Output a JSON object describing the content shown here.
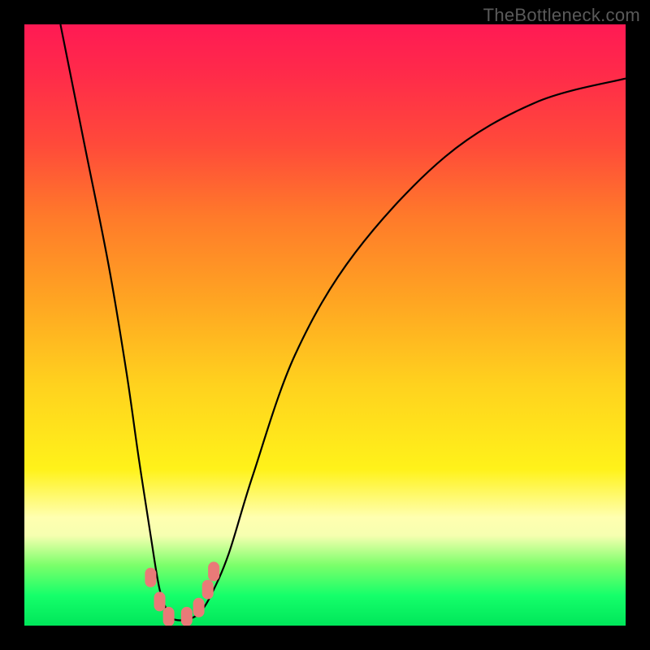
{
  "watermark": "TheBottleneck.com",
  "chart_data": {
    "type": "line",
    "title": "",
    "xlabel": "",
    "ylabel": "",
    "xlim": [
      0,
      100
    ],
    "ylim": [
      0,
      100
    ],
    "series": [
      {
        "name": "curve",
        "x": [
          6,
          10,
          14,
          17,
          19,
          21,
          22.5,
          24,
          25,
          27,
          29,
          31,
          34,
          38,
          45,
          55,
          70,
          85,
          100
        ],
        "values": [
          100,
          80,
          60,
          42,
          28,
          15,
          6,
          2,
          1,
          1,
          2,
          5,
          12,
          25,
          45,
          62,
          78,
          87,
          91
        ]
      }
    ],
    "markers": [
      {
        "x": 21.0,
        "y": 8.0
      },
      {
        "x": 22.5,
        "y": 4.0
      },
      {
        "x": 24.0,
        "y": 1.5
      },
      {
        "x": 27.0,
        "y": 1.5
      },
      {
        "x": 29.0,
        "y": 3.0
      },
      {
        "x": 30.5,
        "y": 6.0
      },
      {
        "x": 31.5,
        "y": 9.0
      }
    ],
    "marker_color": "#e97a78",
    "curve_color": "#000000"
  }
}
